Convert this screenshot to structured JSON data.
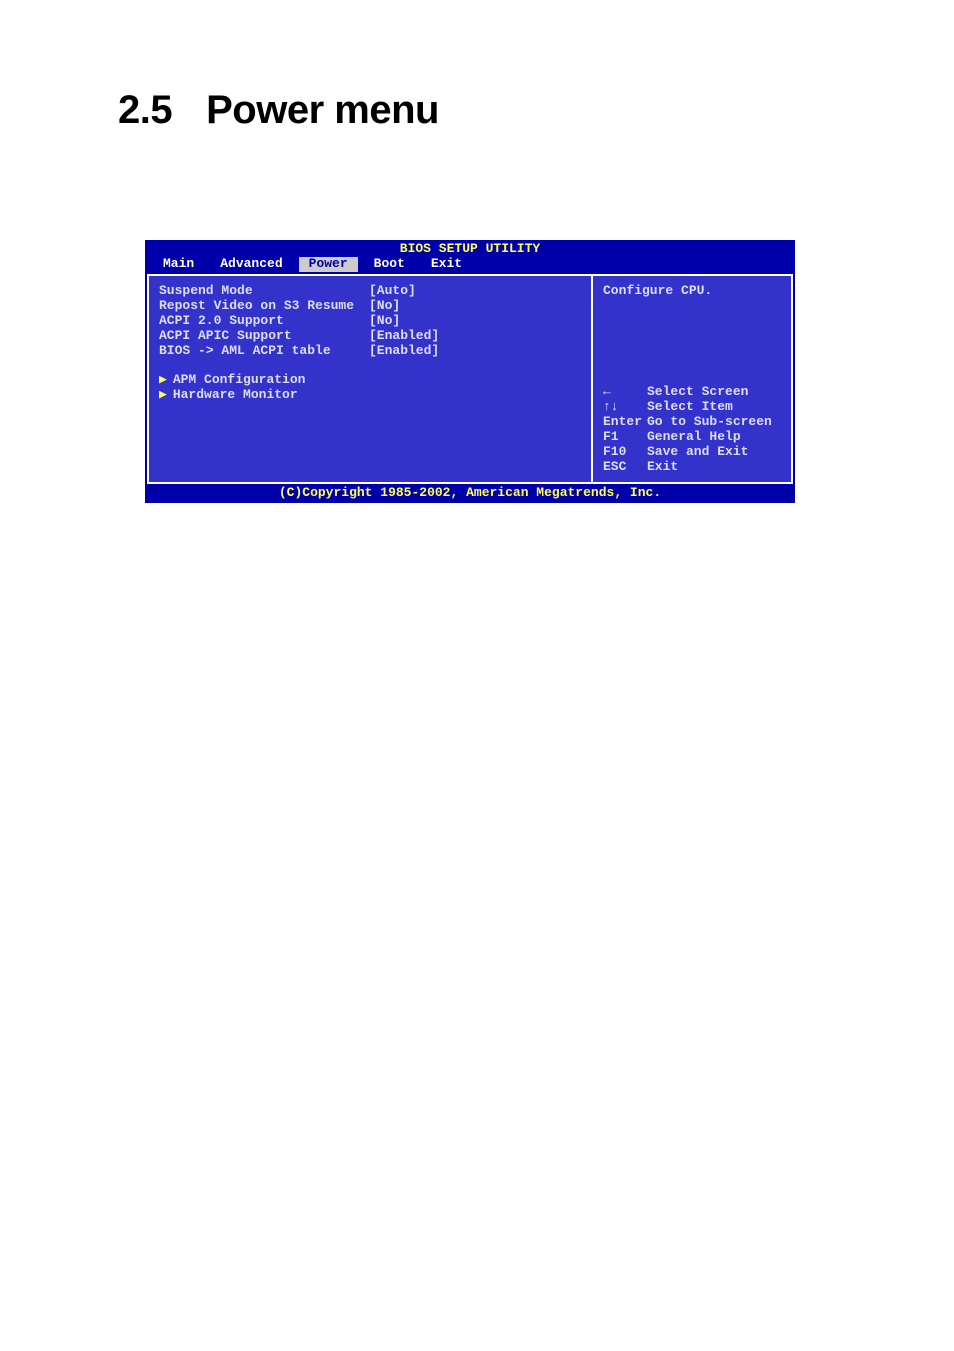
{
  "title": {
    "number": "2.5",
    "text": "Power menu"
  },
  "bios": {
    "header": "BIOS SETUP UTILITY",
    "tabs": {
      "main": "Main",
      "advanced": "Advanced",
      "power": "Power",
      "boot": "Boot",
      "exit": "Exit"
    },
    "items": {
      "suspend_mode": {
        "label": "Suspend Mode",
        "value": "[Auto]"
      },
      "repost_video": {
        "label": "Repost Video on S3 Resume",
        "value": "[No]"
      },
      "acpi20": {
        "label": "ACPI 2.0 Support",
        "value": "[No]"
      },
      "acpi_apic": {
        "label": "ACPI APIC Support",
        "value": "[Enabled]"
      },
      "aml_acpi": {
        "label": "BIOS -> AML ACPI table",
        "value": "[Enabled]"
      },
      "apm_config": {
        "label": "APM Configuration"
      },
      "hw_monitor": {
        "label": "Hardware Monitor"
      }
    },
    "help_header": "Configure CPU.",
    "help_keys": {
      "left": {
        "key": "←",
        "desc": "Select Screen"
      },
      "updown": {
        "key": "↑↓",
        "desc": "Select Item"
      },
      "enter": {
        "key": "Enter",
        "desc": "Go to Sub-screen"
      },
      "f1": {
        "key": "F1",
        "desc": "General Help"
      },
      "f10": {
        "key": "F10",
        "desc": "Save and Exit"
      },
      "esc": {
        "key": "ESC",
        "desc": "Exit"
      }
    },
    "footer": "(C)Copyright 1985-2002, American Megatrends, Inc."
  }
}
